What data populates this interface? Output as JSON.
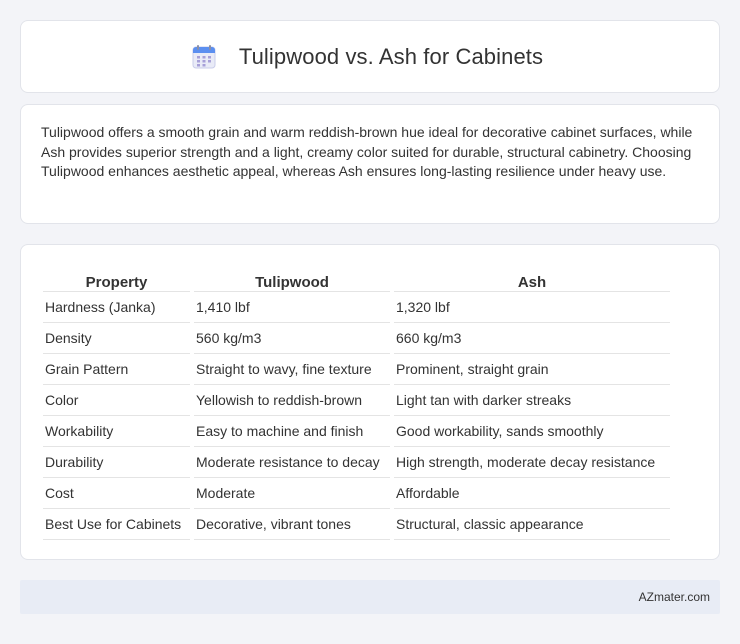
{
  "header": {
    "icon": "calendar-icon",
    "title": "Tulipwood vs. Ash for Cabinets"
  },
  "summary": {
    "text": "Tulipwood offers a smooth grain and warm reddish-brown hue ideal for decorative cabinet surfaces, while Ash provides superior strength and a light, creamy color suited for durable, structural cabinetry. Choosing Tulipwood enhances aesthetic appeal, whereas Ash ensures long-lasting resilience under heavy use."
  },
  "table": {
    "headers": [
      "Property",
      "Tulipwood",
      "Ash"
    ],
    "rows": [
      [
        "Hardness (Janka)",
        "1,410 lbf",
        "1,320 lbf"
      ],
      [
        "Density",
        "560 kg/m3",
        "660 kg/m3"
      ],
      [
        "Grain Pattern",
        "Straight to wavy, fine texture",
        "Prominent, straight grain"
      ],
      [
        "Color",
        "Yellowish to reddish-brown",
        "Light tan with darker streaks"
      ],
      [
        "Workability",
        "Easy to machine and finish",
        "Good workability, sands smoothly"
      ],
      [
        "Durability",
        "Moderate resistance to decay",
        "High strength, moderate decay resistance"
      ],
      [
        "Cost",
        "Moderate",
        "Affordable"
      ],
      [
        "Best Use for Cabinets",
        "Decorative, vibrant tones",
        "Structural, classic appearance"
      ]
    ]
  },
  "footer": {
    "site": "AZmater.com"
  },
  "colors": {
    "background": "#f3f4f8",
    "card": "#ffffff",
    "footer_bg": "#e8ecf5"
  }
}
